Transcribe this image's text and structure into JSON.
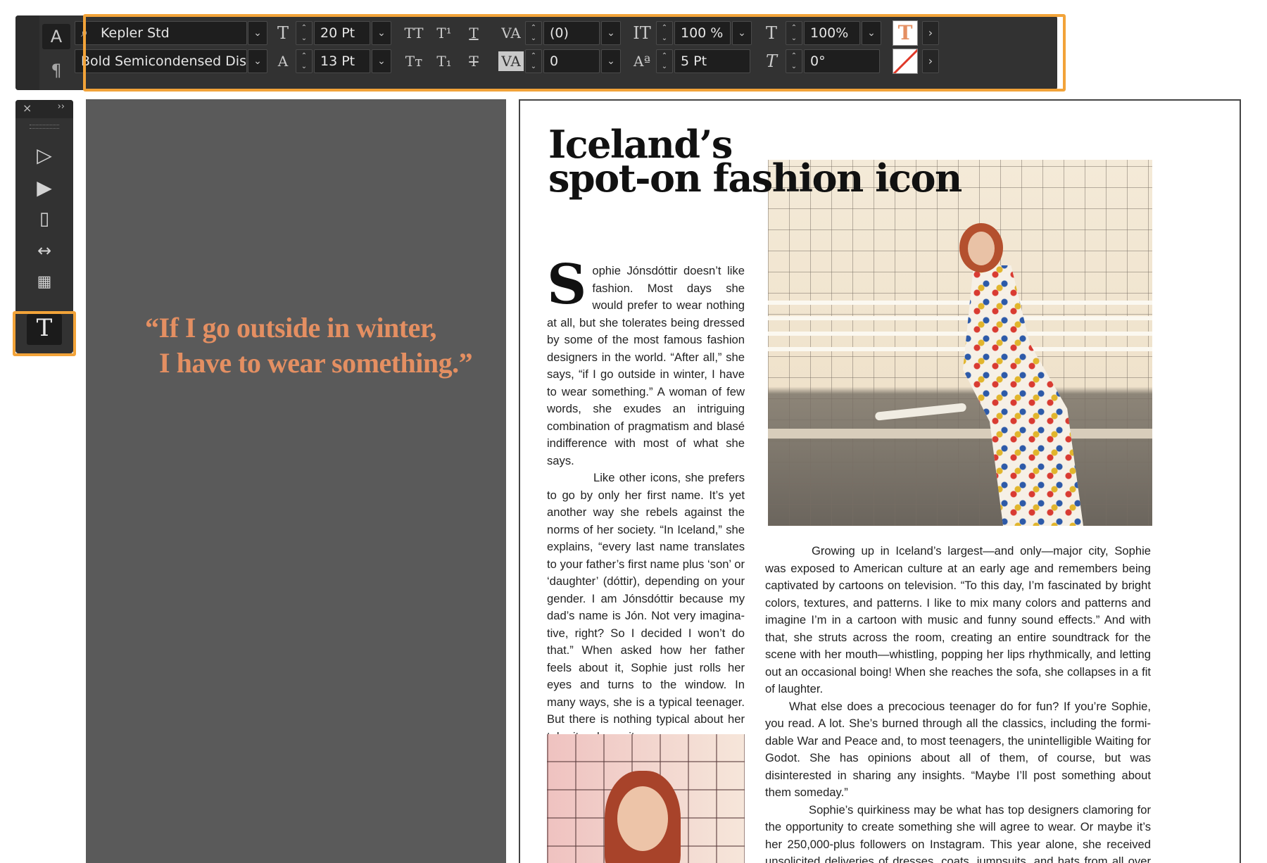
{
  "control_panel": {
    "mode_character": "A",
    "mode_paragraph": "¶",
    "font_family": "Kepler Std",
    "font_style": "Bold Semicondensed Display",
    "font_size": "20 Pt",
    "leading": "13 Pt",
    "kerning": "(0)",
    "tracking": "0",
    "vertical_scale": "100 %",
    "horizontal_scale": "100%",
    "baseline_shift": "5 Pt",
    "skew": "0°",
    "accent_color": "#f2a339"
  },
  "article": {
    "pull_quote_line1": "“If I go outside in winter,",
    "pull_quote_line2": "I have to wear something.”",
    "headline_line1": "Iceland’s",
    "headline_line2": "spot-on fashion icon",
    "dropcap": "S",
    "col1_p1": "ophie Jónsdóttir doesn’t like fashion. Most days she would prefer to wear nothing at all, but she tolerates being dressed by some of the most famous fashion designers in the world. “After all,” she says, “if I go outside in winter, I have to wear something.” A woman of few words, she exudes an intriguing combination of pragmatism and blasé indifference with most of what she says.",
    "col1_p2": "Like other icons, she prefers to go by only her first name. It’s yet another way she rebels against the norms of her society. “In Iceland,” she explains, “every last name translates to your father’s first name plus ‘son’ or ‘daughter’ (dóttir), depending on your gender. I am Jónsdóttir because my dad’s name is Jón. Not very imagina-tive, right? So I decided I won’t do that.” When asked how her father feels about it, Sophie just rolls her eyes and turns to the window. In many ways, she is a typical teenager. But there is nothing typical about her take-it-or-leave-it",
    "col2_p1": "Growing up in Iceland’s largest—and only—major city, Sophie was exposed to American culture at an early age and remembers being captivated by cartoons on television. “To this day, I’m fascinated by bright colors, textures, and patterns. I like to mix many colors and patterns and imagine I’m in a cartoon with music and funny sound effects.” And with that, she struts across the room, creating an entire soundtrack for the scene with her mouth—whistling, popping her lips rhythmically, and letting out an occasional boing! When she reaches the sofa, she collapses in a fit of laughter.",
    "col2_p2": "What else does a precocious teenager do for fun? If you’re Sophie, you read. A lot. She’s burned through all the classics, including the formi-dable War and Peace and, to most teenagers, the unintelligible Waiting for Godot. She has opinions about all of them, of course, but was disinterested in sharing any insights. “Maybe I’ll post something about them someday.”",
    "col2_p3": "Sophie’s quirkiness may be what has top designers clamoring for the opportunity to create something she will agree to wear. Or maybe it’s her 250,000-plus followers on Instagram. This year alone, she received unsolicited deliveries of dresses, coats, jumpsuits, and hats from all over the world. If she has a favorite, she’s not telling. It sometimes seems like a",
    "quote_color": "#e48f62"
  }
}
